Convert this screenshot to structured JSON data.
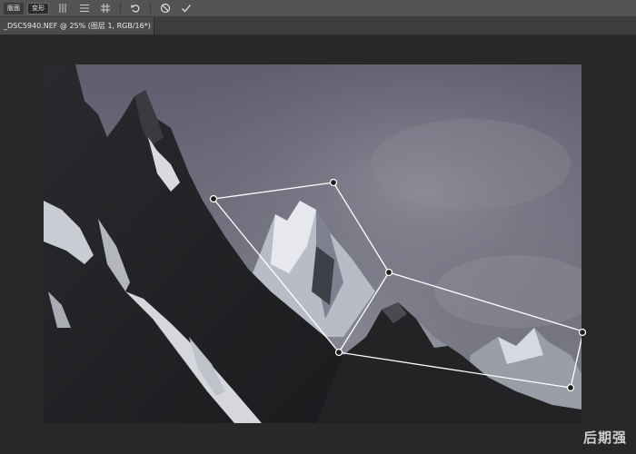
{
  "toolbar": {
    "mode_buttons": [
      {
        "label": "版面",
        "active": false
      },
      {
        "label": "变形",
        "active": true
      }
    ],
    "icons": [
      "vertical-grid-icon",
      "horizontal-grid-icon",
      "hash-grid-icon",
      "undo-icon",
      "cancel-icon",
      "commit-check-icon"
    ]
  },
  "document_tab": {
    "title": "_DSC5940.NEF @ 25% (图层 1, RGB/16*) *"
  },
  "watermark": {
    "text": "后期强"
  },
  "colors": {
    "workspace": "#282828",
    "toolbar": "#535353",
    "tab": "#4a4a4a",
    "handles": "#ffffff"
  }
}
